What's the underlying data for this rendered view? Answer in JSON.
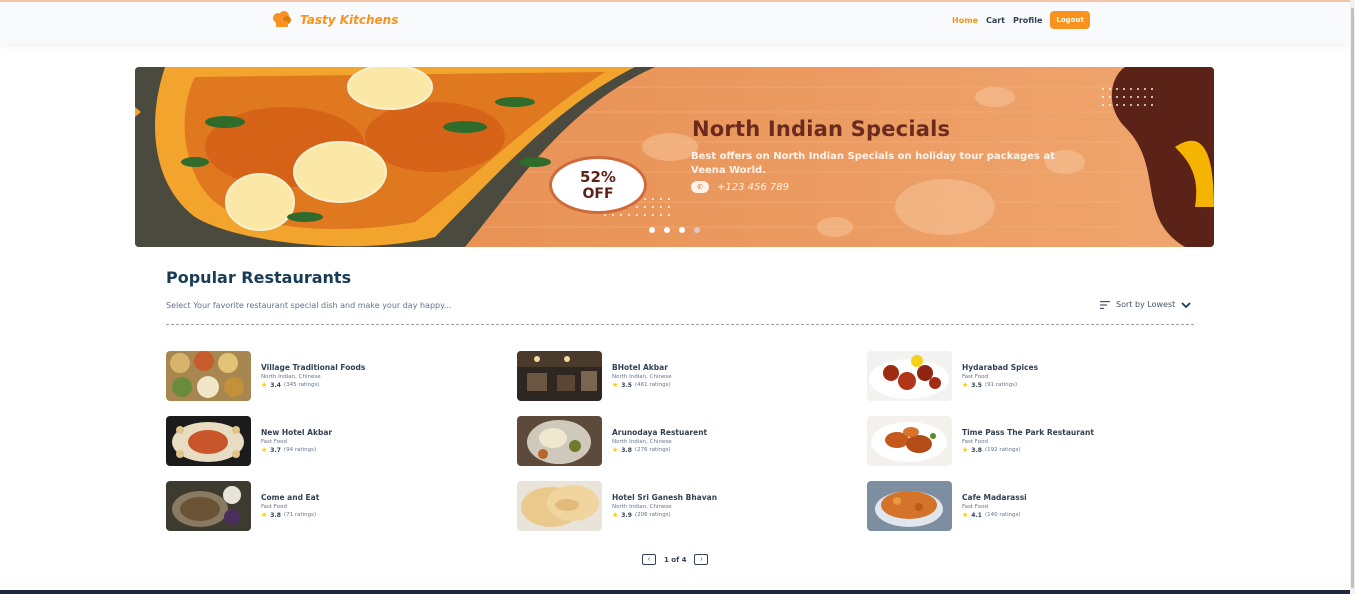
{
  "header": {
    "brand": "Tasty Kitchens",
    "nav": [
      "Home",
      "Cart",
      "Profile"
    ],
    "logout_label": "Logout"
  },
  "banner": {
    "title": "North Indian Specials",
    "subtitle": "Best offers on North Indian Specials on holiday tour packages at Veena World.",
    "phone": "+123 456 789",
    "discount_value": "52%",
    "discount_label": "OFF",
    "active_slide": 4,
    "slide_count": 4
  },
  "section": {
    "title": "Popular Restaurants",
    "description": "Select Your favorite restaurant special dish and make your day happy...",
    "sort_label": "Sort by Lowest"
  },
  "restaurants": [
    {
      "name": "Village Traditional Foods",
      "cuisine": "North Indian, Chinese",
      "rating": "3.4",
      "ratings_count": "(345 ratings)"
    },
    {
      "name": "BHotel Akbar",
      "cuisine": "North Indian, Chinese",
      "rating": "3.5",
      "ratings_count": "(461 ratings)"
    },
    {
      "name": "Hydarabad Spices",
      "cuisine": "Fast Food",
      "rating": "3.5",
      "ratings_count": "(91 ratings)"
    },
    {
      "name": "New Hotel Akbar",
      "cuisine": "Fast Food",
      "rating": "3.7",
      "ratings_count": "(94 ratings)"
    },
    {
      "name": "Arunodaya Restuarent",
      "cuisine": "North Indian, Chinese",
      "rating": "3.8",
      "ratings_count": "(276 ratings)"
    },
    {
      "name": "Time Pass The Park Restaurant",
      "cuisine": "Fast Food",
      "rating": "3.8",
      "ratings_count": "(192 ratings)"
    },
    {
      "name": "Come and Eat",
      "cuisine": "Fast Food",
      "rating": "3.8",
      "ratings_count": "(71 ratings)"
    },
    {
      "name": "Hotel Sri Ganesh Bhavan",
      "cuisine": "North Indian, Chinese",
      "rating": "3.9",
      "ratings_count": "(206 ratings)"
    },
    {
      "name": "Cafe Madarassi",
      "cuisine": "Fast Food",
      "rating": "4.1",
      "ratings_count": "(140 ratings)"
    }
  ],
  "pagination": {
    "text": "1 of 4"
  },
  "colors": {
    "accent": "#f7931e",
    "heading": "#183b56",
    "star": "#ffcc00"
  }
}
